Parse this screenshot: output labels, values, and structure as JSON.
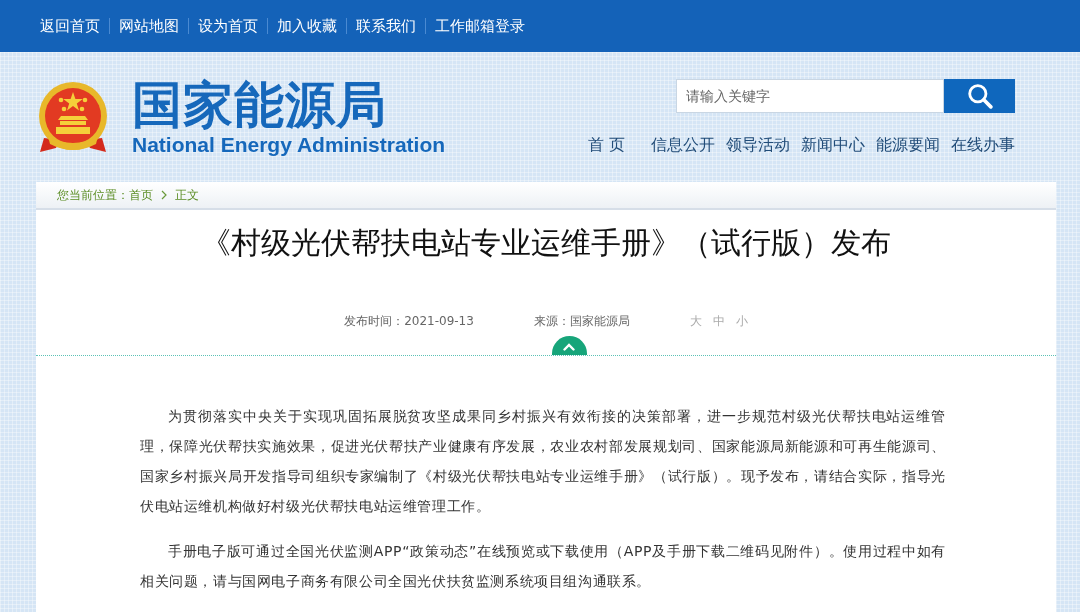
{
  "top_links": [
    "返回首页",
    "网站地图",
    "设为首页",
    "加入收藏",
    "联系我们",
    "工作邮箱登录"
  ],
  "site": {
    "name": "国家能源局",
    "name_en": "National Energy Administration"
  },
  "search": {
    "placeholder": "请输入关键字"
  },
  "nav": [
    "首 页",
    "信息公开",
    "领导活动",
    "新闻中心",
    "能源要闻",
    "在线办事"
  ],
  "breadcrumb": {
    "label": "您当前位置：",
    "items": [
      "首页",
      "正文"
    ]
  },
  "article": {
    "title": "《村级光伏帮扶电站专业运维手册》（试行版）发布",
    "published": "发布时间：2021-09-13",
    "source": "来源：国家能源局",
    "font_sizes": [
      "大",
      "中",
      "小"
    ],
    "paragraphs": [
      "为贯彻落实中央关于实现巩固拓展脱贫攻坚成果同乡村振兴有效衔接的决策部署，进一步规范村级光伏帮扶电站运维管理，保障光伏帮扶实施效果，促进光伏帮扶产业健康有序发展，农业农村部发展规划司、国家能源局新能源和可再生能源司、国家乡村振兴局开发指导司组织专家编制了《村级光伏帮扶电站专业运维手册》（试行版）。现予发布，请结合实际，指导光伏电站运维机构做好村级光伏帮扶电站运维管理工作。",
      "手册电子版可通过全国光伏监测APP“政策动态”在线预览或下载使用（APP及手册下载二维码见附件）。使用过程中如有相关问题，请与国网电子商务有限公司全国光伏扶贫监测系统项目组沟通联系。"
    ]
  }
}
